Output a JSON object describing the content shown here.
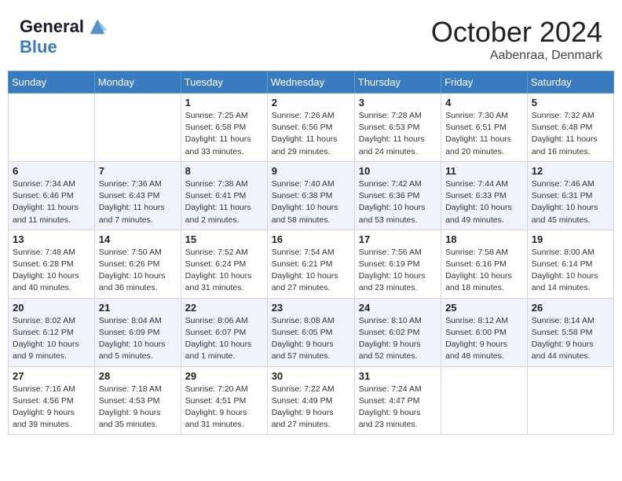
{
  "header": {
    "logo_line1": "General",
    "logo_line2": "Blue",
    "month_title": "October 2024",
    "location": "Aabenraa, Denmark"
  },
  "weekdays": [
    "Sunday",
    "Monday",
    "Tuesday",
    "Wednesday",
    "Thursday",
    "Friday",
    "Saturday"
  ],
  "weeks": [
    [
      {
        "day": "",
        "detail": ""
      },
      {
        "day": "",
        "detail": ""
      },
      {
        "day": "1",
        "detail": "Sunrise: 7:25 AM\nSunset: 6:58 PM\nDaylight: 11 hours\nand 33 minutes."
      },
      {
        "day": "2",
        "detail": "Sunrise: 7:26 AM\nSunset: 6:56 PM\nDaylight: 11 hours\nand 29 minutes."
      },
      {
        "day": "3",
        "detail": "Sunrise: 7:28 AM\nSunset: 6:53 PM\nDaylight: 11 hours\nand 24 minutes."
      },
      {
        "day": "4",
        "detail": "Sunrise: 7:30 AM\nSunset: 6:51 PM\nDaylight: 11 hours\nand 20 minutes."
      },
      {
        "day": "5",
        "detail": "Sunrise: 7:32 AM\nSunset: 6:48 PM\nDaylight: 11 hours\nand 16 minutes."
      }
    ],
    [
      {
        "day": "6",
        "detail": "Sunrise: 7:34 AM\nSunset: 6:46 PM\nDaylight: 11 hours\nand 11 minutes."
      },
      {
        "day": "7",
        "detail": "Sunrise: 7:36 AM\nSunset: 6:43 PM\nDaylight: 11 hours\nand 7 minutes."
      },
      {
        "day": "8",
        "detail": "Sunrise: 7:38 AM\nSunset: 6:41 PM\nDaylight: 11 hours\nand 2 minutes."
      },
      {
        "day": "9",
        "detail": "Sunrise: 7:40 AM\nSunset: 6:38 PM\nDaylight: 10 hours\nand 58 minutes."
      },
      {
        "day": "10",
        "detail": "Sunrise: 7:42 AM\nSunset: 6:36 PM\nDaylight: 10 hours\nand 53 minutes."
      },
      {
        "day": "11",
        "detail": "Sunrise: 7:44 AM\nSunset: 6:33 PM\nDaylight: 10 hours\nand 49 minutes."
      },
      {
        "day": "12",
        "detail": "Sunrise: 7:46 AM\nSunset: 6:31 PM\nDaylight: 10 hours\nand 45 minutes."
      }
    ],
    [
      {
        "day": "13",
        "detail": "Sunrise: 7:48 AM\nSunset: 6:28 PM\nDaylight: 10 hours\nand 40 minutes."
      },
      {
        "day": "14",
        "detail": "Sunrise: 7:50 AM\nSunset: 6:26 PM\nDaylight: 10 hours\nand 36 minutes."
      },
      {
        "day": "15",
        "detail": "Sunrise: 7:52 AM\nSunset: 6:24 PM\nDaylight: 10 hours\nand 31 minutes."
      },
      {
        "day": "16",
        "detail": "Sunrise: 7:54 AM\nSunset: 6:21 PM\nDaylight: 10 hours\nand 27 minutes."
      },
      {
        "day": "17",
        "detail": "Sunrise: 7:56 AM\nSunset: 6:19 PM\nDaylight: 10 hours\nand 23 minutes."
      },
      {
        "day": "18",
        "detail": "Sunrise: 7:58 AM\nSunset: 6:16 PM\nDaylight: 10 hours\nand 18 minutes."
      },
      {
        "day": "19",
        "detail": "Sunrise: 8:00 AM\nSunset: 6:14 PM\nDaylight: 10 hours\nand 14 minutes."
      }
    ],
    [
      {
        "day": "20",
        "detail": "Sunrise: 8:02 AM\nSunset: 6:12 PM\nDaylight: 10 hours\nand 9 minutes."
      },
      {
        "day": "21",
        "detail": "Sunrise: 8:04 AM\nSunset: 6:09 PM\nDaylight: 10 hours\nand 5 minutes."
      },
      {
        "day": "22",
        "detail": "Sunrise: 8:06 AM\nSunset: 6:07 PM\nDaylight: 10 hours\nand 1 minute."
      },
      {
        "day": "23",
        "detail": "Sunrise: 8:08 AM\nSunset: 6:05 PM\nDaylight: 9 hours\nand 57 minutes."
      },
      {
        "day": "24",
        "detail": "Sunrise: 8:10 AM\nSunset: 6:02 PM\nDaylight: 9 hours\nand 52 minutes."
      },
      {
        "day": "25",
        "detail": "Sunrise: 8:12 AM\nSunset: 6:00 PM\nDaylight: 9 hours\nand 48 minutes."
      },
      {
        "day": "26",
        "detail": "Sunrise: 8:14 AM\nSunset: 5:58 PM\nDaylight: 9 hours\nand 44 minutes."
      }
    ],
    [
      {
        "day": "27",
        "detail": "Sunrise: 7:16 AM\nSunset: 4:56 PM\nDaylight: 9 hours\nand 39 minutes."
      },
      {
        "day": "28",
        "detail": "Sunrise: 7:18 AM\nSunset: 4:53 PM\nDaylight: 9 hours\nand 35 minutes."
      },
      {
        "day": "29",
        "detail": "Sunrise: 7:20 AM\nSunset: 4:51 PM\nDaylight: 9 hours\nand 31 minutes."
      },
      {
        "day": "30",
        "detail": "Sunrise: 7:22 AM\nSunset: 4:49 PM\nDaylight: 9 hours\nand 27 minutes."
      },
      {
        "day": "31",
        "detail": "Sunrise: 7:24 AM\nSunset: 4:47 PM\nDaylight: 9 hours\nand 23 minutes."
      },
      {
        "day": "",
        "detail": ""
      },
      {
        "day": "",
        "detail": ""
      }
    ]
  ]
}
